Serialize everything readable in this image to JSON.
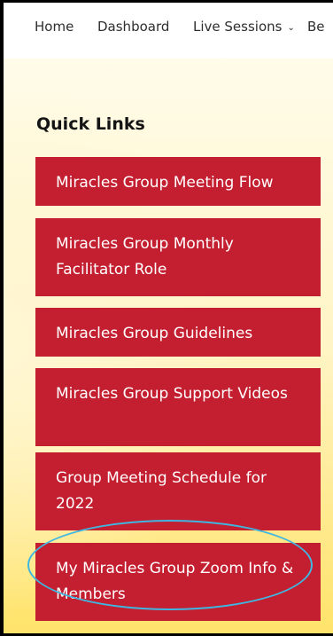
{
  "nav": {
    "home": "Home",
    "dashboard": "Dashboard",
    "live_sessions": "Live Sessions",
    "chevron": "⌄",
    "cut_item": "Be"
  },
  "quick_links": {
    "title": "Quick Links",
    "items": [
      "Miracles Group Meeting Flow",
      "Miracles Group Monthly Facilitator Role",
      "Miracles Group Guidelines",
      "Miracles Group Support Videos",
      "Group Meeting Schedule for 2022",
      "My Miracles Group Zoom Info & Members"
    ]
  },
  "colors": {
    "button_bg": "#c41f30",
    "highlight_ring": "#3fb6e0",
    "background_yellow": "#ffe36a"
  },
  "icons": {
    "live_sessions": "chevron-down-icon"
  }
}
